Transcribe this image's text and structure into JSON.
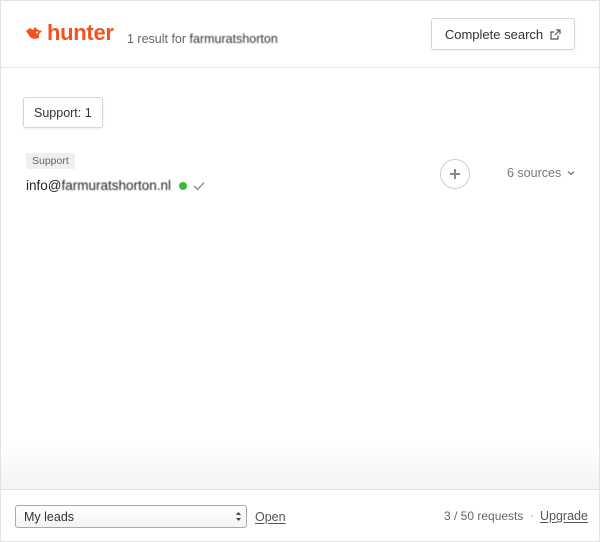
{
  "app": {
    "brand": "hunter",
    "brand_color": "#f4511e"
  },
  "header": {
    "result_prefix": "1 result for",
    "result_domain": "farmuratshorton",
    "complete_search_label": "Complete search",
    "complete_search_icon": "external-link-icon"
  },
  "filters": {
    "department_button": "Support: 1"
  },
  "results": [
    {
      "department": "Support",
      "email_prefix": "info@",
      "email_rest": "farmuratshorton.nl",
      "status_color": "#3cb73c",
      "status_icon": "verified-dot-icon",
      "check_icon": "check-icon",
      "add_icon": "plus-icon",
      "sources_label": "6 sources",
      "sources_icon": "chevron-down-icon"
    }
  ],
  "footer": {
    "leads_select_value": "My leads",
    "open_label": "Open",
    "requests_text": "3 / 50 requests",
    "separator": "·",
    "upgrade_label": "Upgrade"
  }
}
